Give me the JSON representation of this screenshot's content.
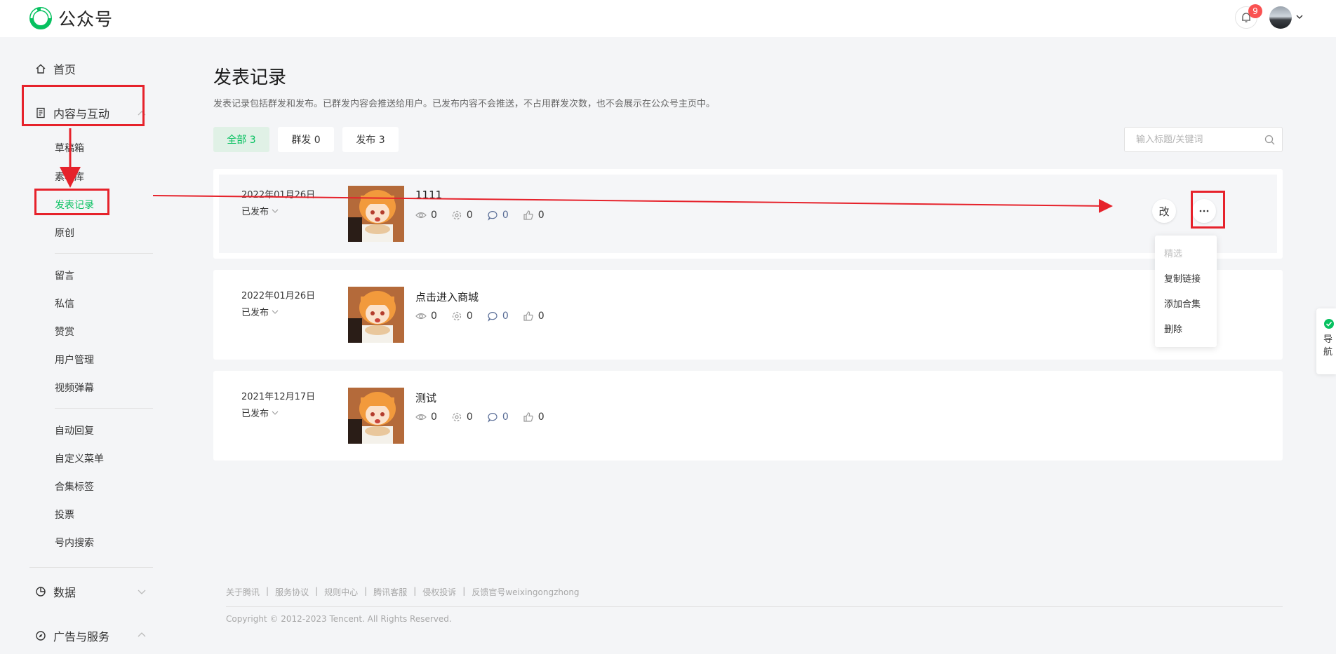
{
  "header": {
    "logo_text": "公众号",
    "notification_count": "9"
  },
  "sidebar": {
    "home": "首页",
    "content_group": "内容与互动",
    "content_items": [
      "草稿箱",
      "素材库",
      "发表记录",
      "原创"
    ],
    "interact_items": [
      "留言",
      "私信",
      "赞赏",
      "用户管理",
      "视频弹幕"
    ],
    "feature_items": [
      "自动回复",
      "自定义菜单",
      "合集标签",
      "投票",
      "号内搜索"
    ],
    "data_group": "数据",
    "ads_group": "广告与服务",
    "active_item": "发表记录"
  },
  "main": {
    "title": "发表记录",
    "description": "发表记录包括群发和发布。已群发内容会推送给用户。已发布内容不会推送，不占用群发次数，也不会展示在公众号主页中。",
    "tabs": [
      {
        "label": "全部 3",
        "active": true
      },
      {
        "label": "群发 0",
        "active": false
      },
      {
        "label": "发布 3",
        "active": false
      }
    ],
    "search_placeholder": "输入标题/关键词"
  },
  "records": [
    {
      "date": "2022年01月26日",
      "status": "已发布",
      "title": "1111",
      "reads": "0",
      "shares": "0",
      "comments": "0",
      "likes": "0"
    },
    {
      "date": "2022年01月26日",
      "status": "已发布",
      "title": "点击进入商城",
      "reads": "0",
      "shares": "0",
      "comments": "0",
      "likes": "0"
    },
    {
      "date": "2021年12月17日",
      "status": "已发布",
      "title": "测试",
      "reads": "0",
      "shares": "0",
      "comments": "0",
      "likes": "0"
    }
  ],
  "actions": {
    "edit_label": "改",
    "more_label": "···",
    "menu": [
      "精选",
      "复制链接",
      "添加合集",
      "删除"
    ]
  },
  "right_nav": {
    "label": "导航"
  },
  "footer": {
    "links": [
      "关于腾讯",
      "服务协议",
      "规则中心",
      "腾讯客服",
      "侵权投诉",
      "反馈官号weixingongzhong"
    ],
    "copyright": "Copyright © 2012-2023 Tencent. All Rights Reserved."
  },
  "colors": {
    "accent": "#07c160",
    "annotation": "#e6222b",
    "link_blue": "#576b95",
    "badge": "#fa5151"
  }
}
